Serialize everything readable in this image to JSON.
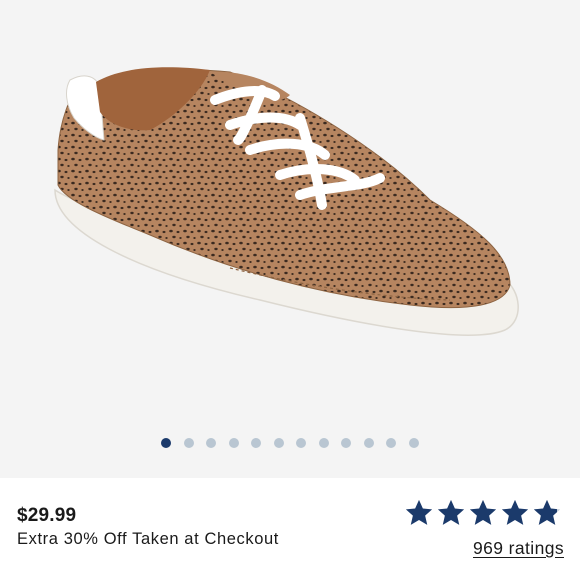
{
  "gallery": {
    "image_alt": "Leopard print lace-up sneaker",
    "dot_count": 12,
    "active_index": 0,
    "colors": {
      "active_dot": "#1b3a6b",
      "inactive_dot": "#b9c6d2",
      "background": "#f4f4f4"
    }
  },
  "product": {
    "price": "$29.99",
    "promo": "Extra 30% Off Taken at Checkout"
  },
  "rating": {
    "stars": 4.8,
    "max_stars": 5,
    "ratings_label": "969 ratings",
    "star_color": "#1b3a6b"
  }
}
